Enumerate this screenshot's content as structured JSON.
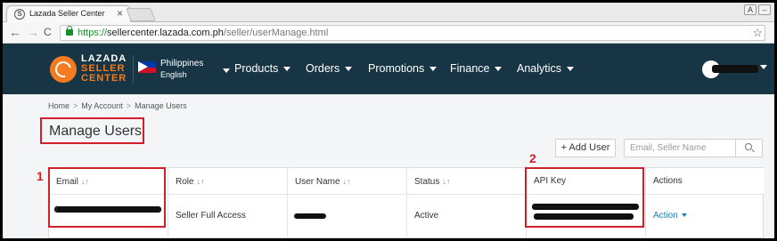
{
  "browser": {
    "tab_title": "Lazada Seller Center",
    "tab_close": "×",
    "url_scheme": "https://",
    "url_host": "sellercenter.lazada.com.ph",
    "url_path": "/seller/userManage.html",
    "back_glyph": "←",
    "forward_glyph": "→",
    "reload_glyph": "C",
    "star_glyph": "☆",
    "win_user_glyph": "A",
    "win_min_glyph": "–",
    "icons": [
      "favicon-icon",
      "close-icon",
      "back-icon",
      "forward-icon",
      "reload-icon",
      "lock-icon",
      "bookmark-star-icon"
    ]
  },
  "header": {
    "logo_line1": "LAZADA",
    "logo_line2": "SELLER",
    "logo_line3": "CENTER",
    "country": "Philippines",
    "language": "English",
    "nav": [
      "Products",
      "Orders",
      "Promotions",
      "Finance",
      "Analytics"
    ],
    "colors": {
      "bar": "#183545",
      "accent": "#f47b20"
    }
  },
  "breadcrumb": [
    "Home",
    "My Account",
    "Manage Users"
  ],
  "breadcrumb_sep": ">",
  "page": {
    "title": "Manage Users",
    "add_user_label": "+ Add User",
    "search_placeholder": "Email, Seller Name"
  },
  "table": {
    "columns": [
      {
        "label": "Email",
        "sortable": true
      },
      {
        "label": "Role",
        "sortable": true
      },
      {
        "label": "User Name",
        "sortable": true
      },
      {
        "label": "Status",
        "sortable": true
      },
      {
        "label": "API Key",
        "sortable": false
      },
      {
        "label": "Actions",
        "sortable": false
      }
    ],
    "sort_glyph": "↓↑",
    "rows": [
      {
        "email_visible_suffix": "t",
        "role": "Seller Full Access",
        "status": "Active",
        "action_label": "Action"
      }
    ]
  },
  "annotations": [
    "1",
    "2"
  ],
  "annotation_color": "#d21f2a"
}
